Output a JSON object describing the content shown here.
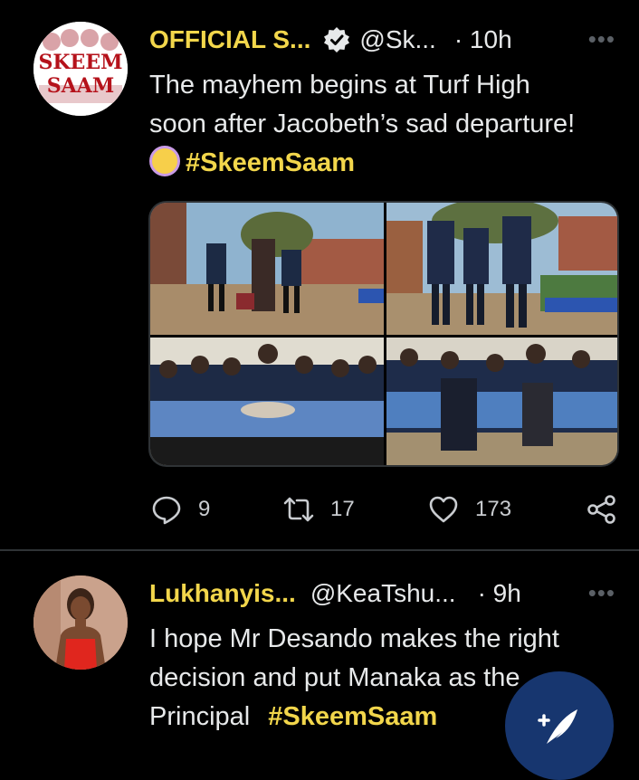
{
  "tweets": [
    {
      "display_name": "OFFICIAL S...",
      "handle": "@Sk...",
      "time": "· 10h",
      "text_line1": "The mayhem begins at Turf High",
      "text_line2": "soon after Jacobeth’s sad departure!",
      "hashtag": "#SkeemSaam",
      "avatar_text_top": "SKEEM",
      "avatar_text_bottom": "SAAM",
      "replies": "9",
      "retweets": "17",
      "likes": "173"
    },
    {
      "display_name": "Lukhanyis...",
      "handle": "@KeaTshu...",
      "time": "· 9h",
      "text_line1": "I hope Mr Desando makes the right",
      "text_line2": "decision and put Manaka as the",
      "text_line3": "Principal",
      "hashtag": "#SkeemSaam"
    }
  ],
  "more_glyph": "•••",
  "icons": {
    "verified": "verified-badge-icon",
    "reply": "reply-icon",
    "retweet": "retweet-icon",
    "like": "heart-icon",
    "share": "share-icon",
    "compose": "compose-tweet-icon"
  },
  "colors": {
    "accent": "#f2d64b",
    "background": "#000000",
    "fab": "#17366f"
  }
}
